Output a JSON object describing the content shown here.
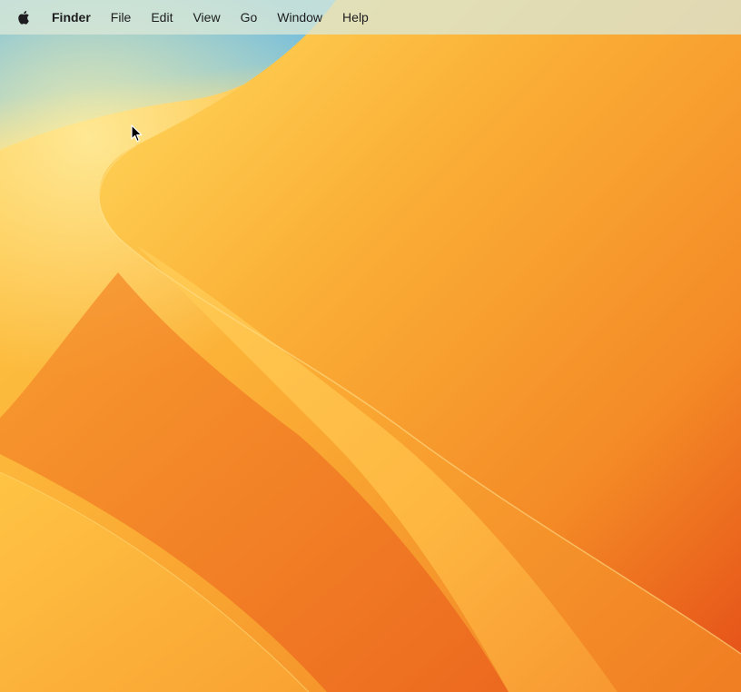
{
  "menubar": {
    "apple_icon": "apple-logo-icon",
    "app_name": "Finder",
    "items": [
      "File",
      "Edit",
      "View",
      "Go",
      "Window",
      "Help"
    ]
  },
  "desktop": {
    "wallpaper": "orange-dunes-wallpaper",
    "colors": {
      "sky": "#5db5e8",
      "light_sand": "#ffd24f",
      "orange": "#f7931f",
      "deep_orange": "#e8551a",
      "menubar_tint": "#dae8d7"
    }
  },
  "cursor": {
    "icon": "arrow-cursor-icon"
  }
}
